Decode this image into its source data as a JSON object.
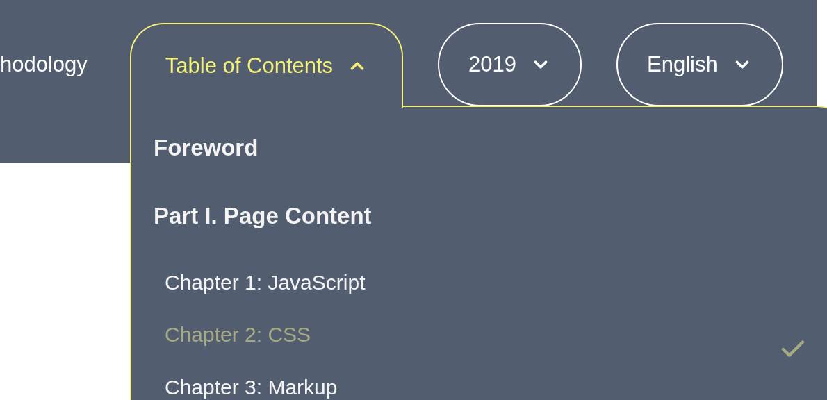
{
  "nav": {
    "partial_link": "hodology"
  },
  "toc_tab": {
    "label": "Table of Contents",
    "expanded": true
  },
  "selects": [
    {
      "label": "2019"
    },
    {
      "label": "English"
    }
  ],
  "toc_menu": [
    {
      "kind": "section",
      "label": "Foreword"
    },
    {
      "kind": "section",
      "label": "Part I. Page Content"
    },
    {
      "kind": "chapter",
      "label": "Chapter 1: JavaScript",
      "selected": false
    },
    {
      "kind": "chapter",
      "label": "Chapter 2: CSS",
      "selected": true
    },
    {
      "kind": "chapter",
      "label": "Chapter 3: Markup",
      "selected": false
    }
  ]
}
